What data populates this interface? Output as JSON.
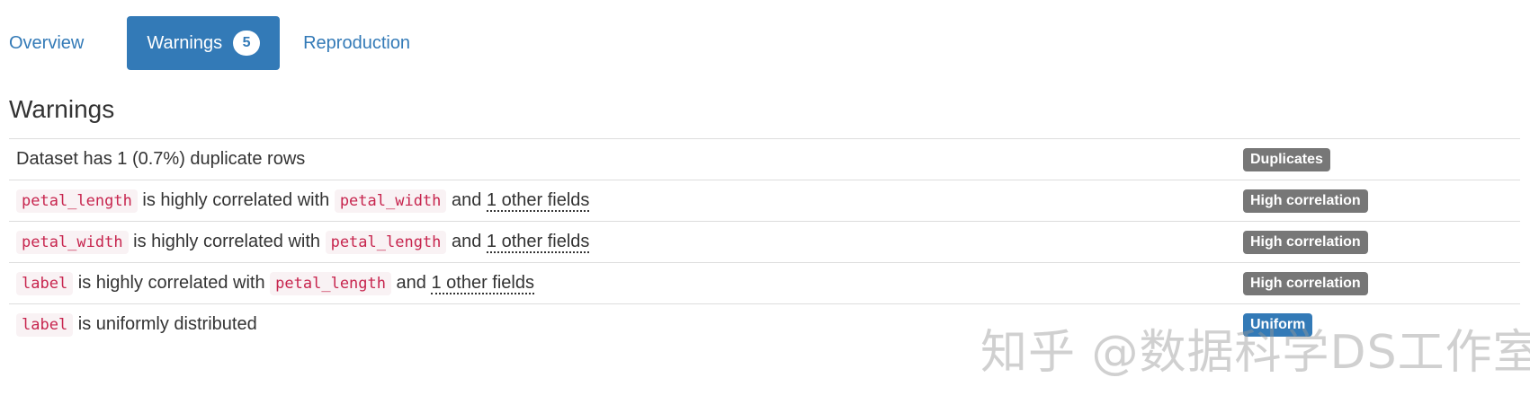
{
  "tabs": [
    {
      "label": "Overview",
      "active": false
    },
    {
      "label": "Warnings",
      "active": true,
      "badge": "5"
    },
    {
      "label": "Reproduction",
      "active": false
    }
  ],
  "section_title": "Warnings",
  "warnings": [
    {
      "parts": [
        {
          "type": "text",
          "value": "Dataset has 1 (0.7%) duplicate rows"
        }
      ],
      "label": "Duplicates",
      "label_style": "default"
    },
    {
      "parts": [
        {
          "type": "code",
          "value": "petal_length"
        },
        {
          "type": "text",
          "value": " is highly correlated with "
        },
        {
          "type": "code",
          "value": "petal_width"
        },
        {
          "type": "text",
          "value": " and "
        },
        {
          "type": "abbr",
          "value": "1 other fields"
        }
      ],
      "label": "High correlation",
      "label_style": "default"
    },
    {
      "parts": [
        {
          "type": "code",
          "value": "petal_width"
        },
        {
          "type": "text",
          "value": " is highly correlated with "
        },
        {
          "type": "code",
          "value": "petal_length"
        },
        {
          "type": "text",
          "value": " and "
        },
        {
          "type": "abbr",
          "value": "1 other fields"
        }
      ],
      "label": "High correlation",
      "label_style": "default"
    },
    {
      "parts": [
        {
          "type": "code",
          "value": "label"
        },
        {
          "type": "text",
          "value": " is highly correlated with "
        },
        {
          "type": "code",
          "value": "petal_length"
        },
        {
          "type": "text",
          "value": " and "
        },
        {
          "type": "abbr",
          "value": "1 other fields"
        }
      ],
      "label": "High correlation",
      "label_style": "default"
    },
    {
      "parts": [
        {
          "type": "code",
          "value": "label"
        },
        {
          "type": "text",
          "value": " is uniformly distributed"
        }
      ],
      "label": "Uniform",
      "label_style": "info"
    }
  ],
  "watermark": "知乎 @数据科学DS工作室",
  "colors": {
    "accent": "#337ab7",
    "badge_default": "#777777",
    "code_text": "#c7254e",
    "code_bg": "#f9f2f4",
    "border": "#dddddd"
  }
}
